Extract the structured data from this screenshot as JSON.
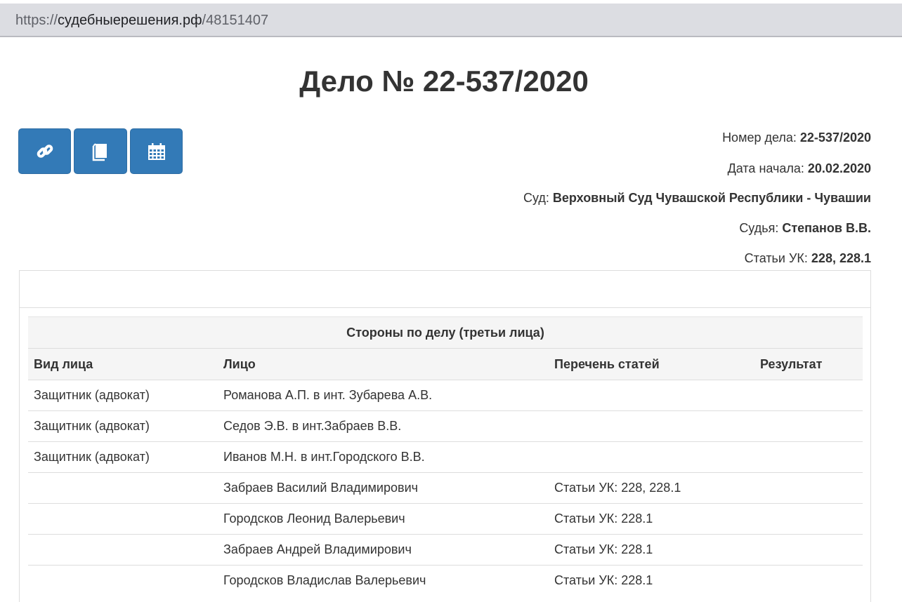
{
  "browser": {
    "url_scheme": "https://",
    "url_host": "судебныерешения.рф",
    "url_path": "/48151407"
  },
  "page_title": "Дело № 22-537/2020",
  "toolbar": {
    "icons": [
      "link-icon",
      "book-icon",
      "calendar-icon"
    ],
    "color": "#337ab7"
  },
  "meta": {
    "case_number_label": "Номер дела: ",
    "case_number": "22-537/2020",
    "start_date_label": "Дата начала: ",
    "start_date": "20.02.2020",
    "court_label": "Суд: ",
    "court": "Верховный Суд Чувашской Республики - Чувашии",
    "judge_label": "Судья: ",
    "judge": "Степанов В.В.",
    "articles_label": "Статьи УК: ",
    "articles": "228, 228.1"
  },
  "parties": {
    "caption": "Стороны по делу (третьи лица)",
    "columns": [
      "Вид лица",
      "Лицо",
      "Перечень статей",
      "Результат"
    ],
    "rows": [
      [
        "Защитник (адвокат)",
        "Романова А.П. в инт. Зубарева А.В.",
        "",
        ""
      ],
      [
        "Защитник (адвокат)",
        "Седов Э.В. в инт.Забраев В.В.",
        "",
        ""
      ],
      [
        "Защитник (адвокат)",
        "Иванов М.Н. в инт.Городского В.В.",
        "",
        ""
      ],
      [
        "",
        "Забраев Василий Владимирович",
        "Статьи УК: 228, 228.1",
        ""
      ],
      [
        "",
        "Городсков Леонид Валерьевич",
        "Статьи УК: 228.1",
        ""
      ],
      [
        "",
        "Забраев Андрей Владимирович",
        "Статьи УК: 228.1",
        ""
      ],
      [
        "",
        "Городсков Владислав Валерьевич",
        "Статьи УК: 228.1",
        ""
      ]
    ]
  }
}
